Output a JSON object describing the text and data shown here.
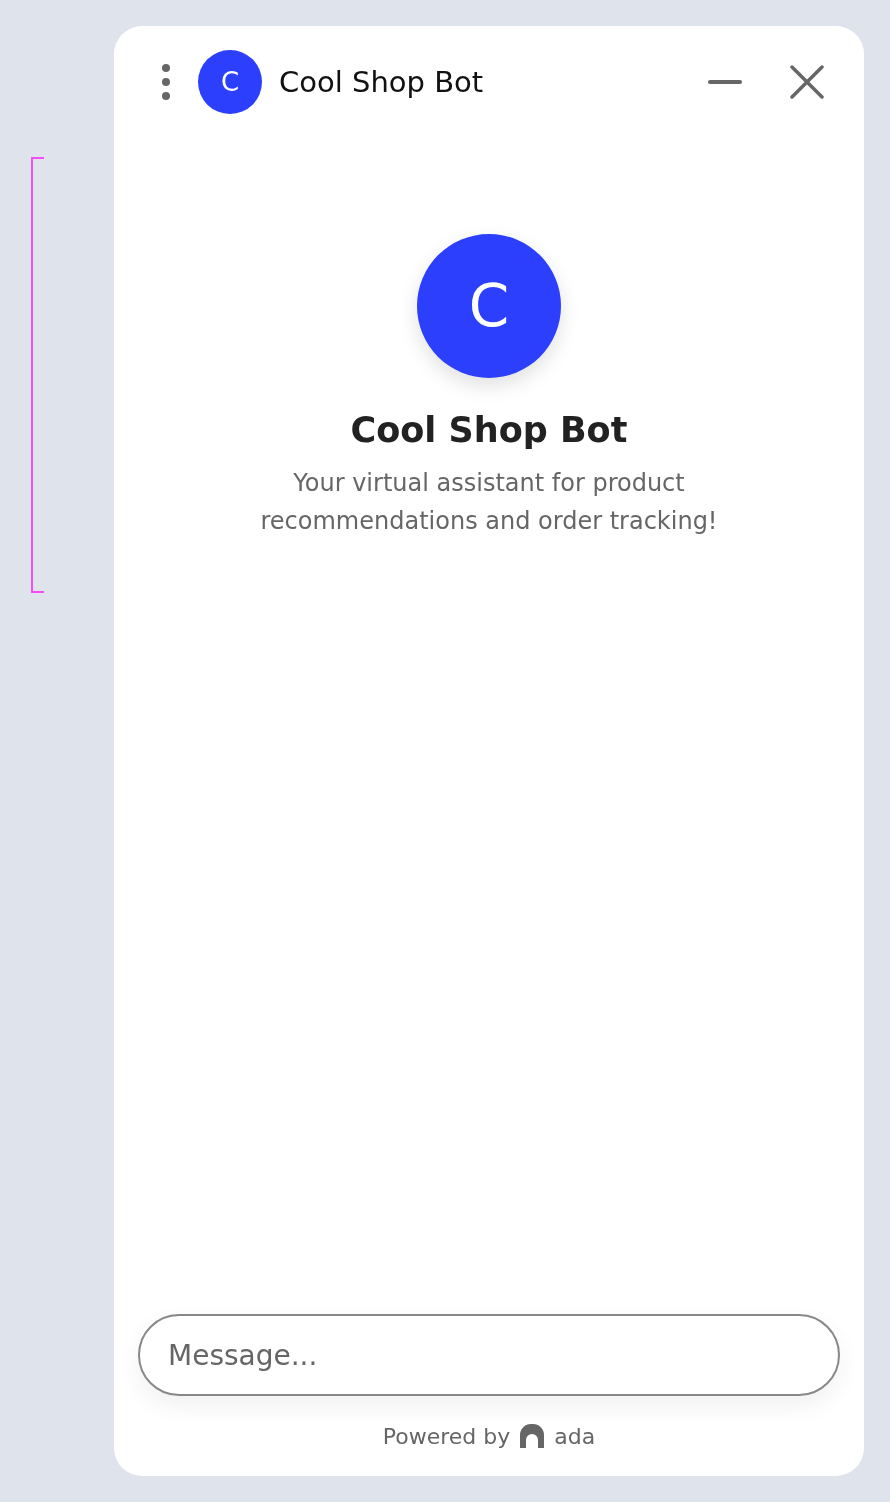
{
  "header": {
    "avatar_letter": "C",
    "title": "Cool Shop Bot"
  },
  "intro": {
    "avatar_letter": "C",
    "title": "Cool Shop Bot",
    "description": "Your virtual assistant for product recommendations and order tracking!"
  },
  "composer": {
    "placeholder": "Message..."
  },
  "footer": {
    "powered_by": "Powered by",
    "brand": "ada"
  }
}
